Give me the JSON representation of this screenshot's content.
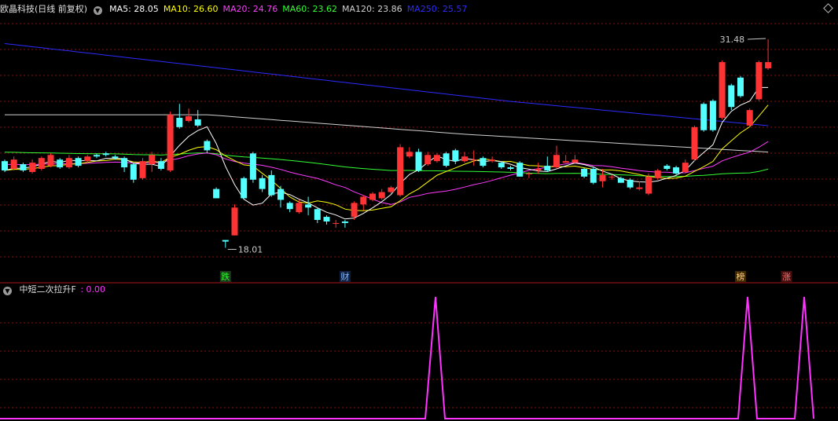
{
  "header": {
    "title": "欧晶科技(日线 前复权)",
    "ma": [
      {
        "label": "MA5: 28.05",
        "color": "#ffffff"
      },
      {
        "label": "MA10: 26.60",
        "color": "#ffff00"
      },
      {
        "label": "MA20: 24.76",
        "color": "#ff3cff"
      },
      {
        "label": "MA60: 23.62",
        "color": "#33ff33"
      },
      {
        "label": "MA120: 23.86",
        "color": "#d0d0d0"
      },
      {
        "label": "MA250: 25.57",
        "color": "#2b2bff"
      }
    ]
  },
  "indicator": {
    "label": "中短二次拉升F",
    "value": ": 0.00",
    "color": "#ff33ff"
  },
  "icons": {
    "collapse": "chevron-down-icon",
    "expand": "diamond-icon"
  },
  "colors": {
    "up": "#ff3333",
    "down": "#54ffff",
    "grid": "#8a1010",
    "ma250": "#2b2bff"
  },
  "chart_data": [
    {
      "type": "candlestick",
      "ylim": [
        16.5,
        33.0
      ],
      "high_label": "31.48",
      "low_label": "18.01",
      "markers": [
        {
          "index": 24,
          "text": "跌",
          "color": "#30ff30",
          "bg": "#1c3a1c"
        },
        {
          "index": 37,
          "text": "财",
          "color": "#7fb6ff",
          "bg": "#102040"
        },
        {
          "index": 80,
          "text": "榜",
          "color": "#ffd080",
          "bg": "#402800"
        },
        {
          "index": 85,
          "text": "涨",
          "color": "#ff7070",
          "bg": "#401010"
        }
      ],
      "series": [
        {
          "name": "MA120",
          "color": "#d0d0d0",
          "values": [
            26.7,
            26.4
          ]
        },
        {
          "name": "MA250",
          "color": "#2b2bff"
        }
      ],
      "candles": [
        [
          23.6,
          23.0,
          23.7,
          22.9
        ],
        [
          23.1,
          23.7,
          23.9,
          23.0
        ],
        [
          23.4,
          23.0,
          23.5,
          22.9
        ],
        [
          22.9,
          23.5,
          23.7,
          22.8
        ],
        [
          23.1,
          23.8,
          23.9,
          23.0
        ],
        [
          23.3,
          24.0,
          24.1,
          23.2
        ],
        [
          23.7,
          23.2,
          23.8,
          23.1
        ],
        [
          23.2,
          23.8,
          24.0,
          23.1
        ],
        [
          23.8,
          23.3,
          23.9,
          23.2
        ],
        [
          23.6,
          23.9,
          24.0,
          23.5
        ],
        [
          24.0,
          23.9,
          24.1,
          23.8
        ],
        [
          24.1,
          24.0,
          24.2,
          23.9
        ],
        [
          23.9,
          23.8,
          24.0,
          23.7
        ],
        [
          23.8,
          23.2,
          23.9,
          22.9
        ],
        [
          23.4,
          22.4,
          23.5,
          22.2
        ],
        [
          22.5,
          23.6,
          23.8,
          22.4
        ],
        [
          23.4,
          24.0,
          24.2,
          22.9
        ],
        [
          23.6,
          23.1,
          23.8,
          23.0
        ],
        [
          23.0,
          26.6,
          26.8,
          22.9
        ],
        [
          26.4,
          25.8,
          27.3,
          25.7
        ],
        [
          26.2,
          26.5,
          27.0,
          26.1
        ],
        [
          26.3,
          25.9,
          26.9,
          25.8
        ],
        [
          24.9,
          24.3,
          25.0,
          24.1
        ],
        [
          21.8,
          21.2,
          21.9,
          21.2
        ],
        [
          18.5,
          18.4,
          18.5,
          18.0
        ],
        [
          18.8,
          20.6,
          20.8,
          18.8
        ],
        [
          22.5,
          21.2,
          22.6,
          21.2
        ],
        [
          24.1,
          22.4,
          24.2,
          22.2
        ],
        [
          22.5,
          21.8,
          22.7,
          21.6
        ],
        [
          22.7,
          21.4,
          23.0,
          21.3
        ],
        [
          21.8,
          21.1,
          22.0,
          20.6
        ],
        [
          20.9,
          20.5,
          21.0,
          20.3
        ],
        [
          20.3,
          20.9,
          21.1,
          20.2
        ],
        [
          20.8,
          20.6,
          21.3,
          20.1
        ],
        [
          20.5,
          19.8,
          20.6,
          19.6
        ],
        [
          20.0,
          19.7,
          20.1,
          19.5
        ],
        [
          19.6,
          19.6,
          19.8,
          19.3
        ],
        [
          19.7,
          19.6,
          19.8,
          19.3
        ],
        [
          20.0,
          20.9,
          21.0,
          19.8
        ],
        [
          20.8,
          21.3,
          21.4,
          20.4
        ],
        [
          21.1,
          21.5,
          21.6,
          21.0
        ],
        [
          21.2,
          21.6,
          21.8,
          21.1
        ],
        [
          21.6,
          21.9,
          22.0,
          21.5
        ],
        [
          21.4,
          24.5,
          24.7,
          21.3
        ],
        [
          23.9,
          24.2,
          24.5,
          23.8
        ],
        [
          24.2,
          23.0,
          24.4,
          22.9
        ],
        [
          23.4,
          24.0,
          24.2,
          23.3
        ],
        [
          23.6,
          24.0,
          24.1,
          23.5
        ],
        [
          24.1,
          23.3,
          24.2,
          23.2
        ],
        [
          24.3,
          23.6,
          24.4,
          23.4
        ],
        [
          23.6,
          23.9,
          24.2,
          23.5
        ],
        [
          23.7,
          23.7,
          24.3,
          23.3
        ],
        [
          23.8,
          23.3,
          23.9,
          23.2
        ],
        [
          23.6,
          23.7,
          23.9,
          23.5
        ],
        [
          23.5,
          23.2,
          23.6,
          23.1
        ],
        [
          23.2,
          23.1,
          23.3,
          23.0
        ],
        [
          23.5,
          22.6,
          23.6,
          22.6
        ],
        [
          22.8,
          22.8,
          22.9,
          22.5
        ],
        [
          23.0,
          23.1,
          23.5,
          22.8
        ],
        [
          23.3,
          23.0,
          23.9,
          22.9
        ],
        [
          23.2,
          24.0,
          24.6,
          23.1
        ],
        [
          23.5,
          23.6,
          24.0,
          23.5
        ],
        [
          23.5,
          23.7,
          24.0,
          23.4
        ],
        [
          23.1,
          22.6,
          23.2,
          22.5
        ],
        [
          23.1,
          22.2,
          23.2,
          22.1
        ],
        [
          22.3,
          22.7,
          23.1,
          21.9
        ],
        [
          22.6,
          22.6,
          22.7,
          22.4
        ],
        [
          22.5,
          22.2,
          22.6,
          22.2
        ],
        [
          22.4,
          21.9,
          22.5,
          21.8
        ],
        [
          21.8,
          21.9,
          22.3,
          21.7
        ],
        [
          21.5,
          22.6,
          22.8,
          21.4
        ],
        [
          22.5,
          23.0,
          23.1,
          22.4
        ],
        [
          23.3,
          23.1,
          23.4,
          23.0
        ],
        [
          23.2,
          22.8,
          23.3,
          22.7
        ],
        [
          22.9,
          23.5,
          23.7,
          22.8
        ],
        [
          23.7,
          25.8,
          25.9,
          23.6
        ],
        [
          27.3,
          25.6,
          27.4,
          25.5
        ],
        [
          27.5,
          25.6,
          27.6,
          25.5
        ],
        [
          26.4,
          30.0,
          30.1,
          26.3
        ],
        [
          28.5,
          27.1,
          28.6,
          26.9
        ],
        [
          29.0,
          27.8,
          29.1,
          27.7
        ],
        [
          25.9,
          26.9,
          27.0,
          25.8
        ],
        [
          27.6,
          30.0,
          30.1,
          27.5
        ],
        [
          29.6,
          30.0,
          31.48,
          29.5
        ]
      ]
    },
    {
      "type": "line",
      "name": "中短二次拉升F",
      "ylim": [
        0,
        1
      ],
      "points": [
        [
          0,
          0
        ],
        [
          541,
          0
        ],
        [
          554,
          1
        ],
        [
          566,
          0
        ],
        [
          939,
          0
        ],
        [
          951,
          1
        ],
        [
          963,
          0
        ],
        [
          1011,
          0
        ],
        [
          1023,
          1
        ],
        [
          1035,
          0
        ]
      ]
    }
  ]
}
